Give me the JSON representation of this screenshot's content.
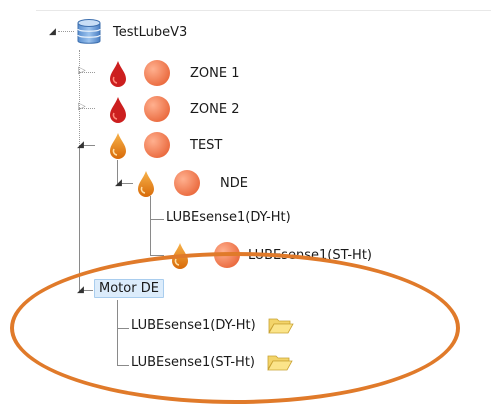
{
  "tree": {
    "root": {
      "label": "TestLubeV3",
      "icon": "database-icon"
    },
    "nodes": [
      {
        "label": "ZONE 1",
        "drop_color": "#cc1f1f",
        "status_color": "#f07a55"
      },
      {
        "label": "ZONE 2",
        "drop_color": "#cc1f1f",
        "status_color": "#f07a55"
      },
      {
        "label": "TEST",
        "drop_color": "#e8820e",
        "status_color": "#f07a55"
      },
      {
        "label": "NDE",
        "drop_color": "#e8820e",
        "status_color": "#f07a55"
      },
      {
        "label": "LUBEsense1(DY-Ht)"
      },
      {
        "label": "LUBEsense1(ST-Ht)",
        "drop_color": "#e8820e",
        "status_color": "#f07a55"
      },
      {
        "label": "Motor DE",
        "selected": true
      },
      {
        "label": "LUBEsense1(DY-Ht)",
        "icon": "folder-open-icon"
      },
      {
        "label": "LUBEsense1(ST-Ht)",
        "icon": "folder-open-icon"
      }
    ],
    "highlight_color": "#e07a2a"
  }
}
